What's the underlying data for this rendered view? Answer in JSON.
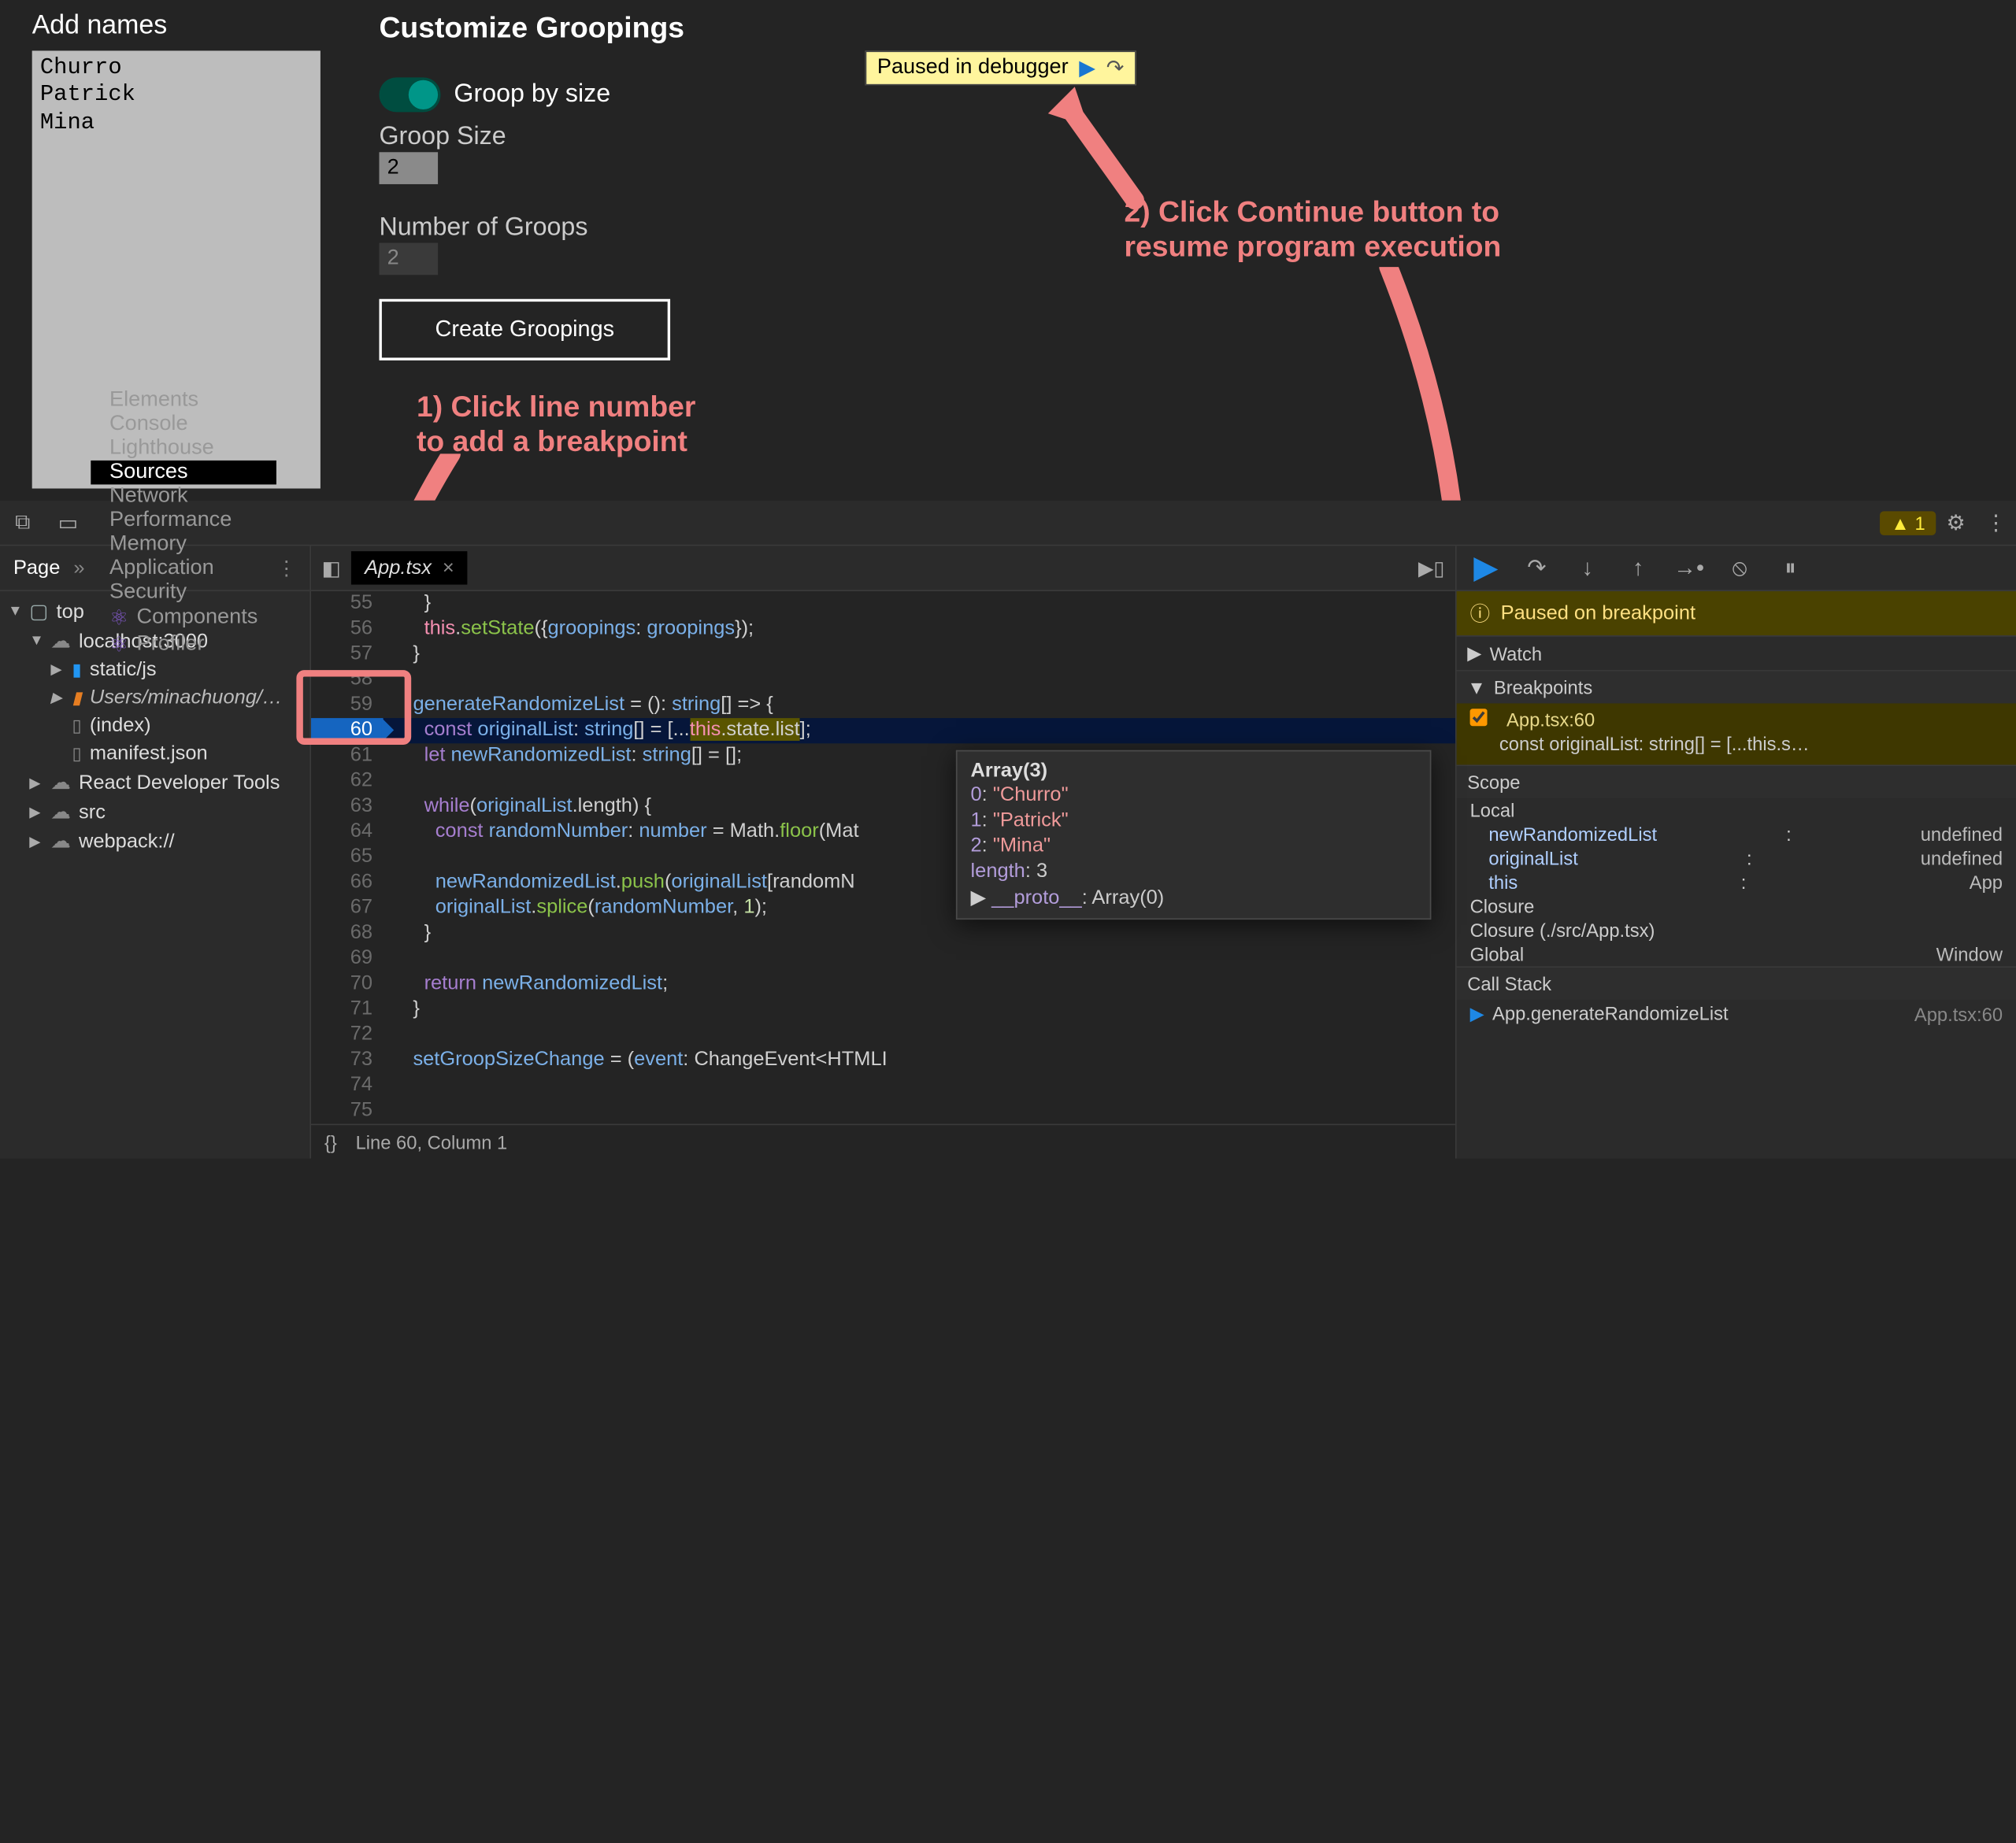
{
  "page": {
    "add_names_label": "Add names",
    "names_text": "Churro\nPatrick\nMina",
    "section_title": "Customize Groopings",
    "toggle_label": "Groop by size",
    "groop_size_label": "Groop Size",
    "groop_size_value": "2",
    "num_groops_label": "Number of Groops",
    "num_groops_value": "2",
    "create_label": "Create Groopings"
  },
  "paused_overlay": {
    "text": "Paused in debugger",
    "resume_glyph": "▶",
    "step_glyph": "↷"
  },
  "annotations": {
    "step1_line1": "1) Click line number",
    "step1_line2": "to add a breakpoint",
    "step2_line1": "2) Click Continue button to",
    "step2_line2": "resume program execution"
  },
  "devtools": {
    "tabs": [
      "Elements",
      "Console",
      "Lighthouse",
      "Sources",
      "Network",
      "Performance",
      "Memory",
      "Application",
      "Security",
      "Components",
      "Profiler"
    ],
    "active_tab": "Sources",
    "warn_count": "1",
    "nav": {
      "header": "Page",
      "more": "»",
      "tree": [
        {
          "depth": 0,
          "icon": "frame",
          "label": "top",
          "expander": "▼"
        },
        {
          "depth": 1,
          "icon": "cloud",
          "label": "localhost:3000",
          "expander": "▼"
        },
        {
          "depth": 2,
          "icon": "folderb",
          "label": "static/js",
          "expander": "▶"
        },
        {
          "depth": 2,
          "icon": "foldero",
          "label": "Users/minachuong/…",
          "italic": true,
          "expander": "▶"
        },
        {
          "depth": 2,
          "icon": "file",
          "label": "(index)"
        },
        {
          "depth": 2,
          "icon": "file",
          "label": "manifest.json"
        },
        {
          "depth": 1,
          "icon": "cloud",
          "label": "React Developer Tools",
          "expander": "▶"
        },
        {
          "depth": 1,
          "icon": "cloud",
          "label": "src",
          "expander": "▶"
        },
        {
          "depth": 1,
          "icon": "cloud",
          "label": "webpack://",
          "expander": "▶"
        }
      ]
    },
    "file_tab": "App.tsx",
    "code_lines": [
      {
        "n": 55,
        "html": "    }"
      },
      {
        "n": 56,
        "html": "    <span class='kwthis'>this</span>.<span class='func'>setState</span>({<span class='ident'>groopings</span>: <span class='ident'>groopings</span>});"
      },
      {
        "n": 57,
        "html": "  }"
      },
      {
        "n": 58,
        "html": ""
      },
      {
        "n": 59,
        "html": "  <span class='ident'>generateRandomizeList</span> = (): <span class='ident'>string</span>[] =&gt; {"
      },
      {
        "n": 60,
        "html": "    <span class='kw'>const</span> <span class='ident'>originalList</span>: <span class='ident'>string</span>[] = [...<span class='hl-this'><span class='kwthis'>this</span>.state.list</span>];",
        "bp": true,
        "current": true
      },
      {
        "n": 61,
        "html": "    <span class='kw'>let</span> <span class='ident'>newRandomizedList</span>: <span class='ident'>string</span>[] = [];"
      },
      {
        "n": 62,
        "html": ""
      },
      {
        "n": 63,
        "html": "    <span class='kw'>while</span>(<span class='ident'>originalList</span>.length) {"
      },
      {
        "n": 64,
        "html": "      <span class='kw'>const</span> <span class='ident'>randomNumber</span>: <span class='ident'>number</span> = Math.<span class='func'>floor</span>(Mat"
      },
      {
        "n": 65,
        "html": ""
      },
      {
        "n": 66,
        "html": "      <span class='ident'>newRandomizedList</span>.<span class='func'>push</span>(<span class='ident'>originalList</span>[randomN"
      },
      {
        "n": 67,
        "html": "      <span class='ident'>originalList</span>.<span class='func'>splice</span>(<span class='ident'>randomNumber</span>, <span class='num'>1</span>);"
      },
      {
        "n": 68,
        "html": "    }"
      },
      {
        "n": 69,
        "html": ""
      },
      {
        "n": 70,
        "html": "    <span class='kw'>return</span> <span class='ident'>newRandomizedList</span>;"
      },
      {
        "n": 71,
        "html": "  }"
      },
      {
        "n": 72,
        "html": ""
      },
      {
        "n": 73,
        "html": "  <span class='ident'>setGroopSizeChange</span> = (<span class='ident'>event</span>: ChangeEvent&lt;HTMLI"
      },
      {
        "n": 74,
        "html": ""
      },
      {
        "n": 75,
        "html": ""
      }
    ],
    "status": {
      "left_glyph": "{}",
      "pos": "Line 60, Column 1"
    },
    "tooltip": {
      "header": "Array(3)",
      "rows": [
        {
          "k": "0",
          "v": "\"Churro\""
        },
        {
          "k": "1",
          "v": "\"Patrick\""
        },
        {
          "k": "2",
          "v": "\"Mina\""
        }
      ],
      "length_label": "length",
      "length_value": "3",
      "proto_label": "__proto__",
      "proto_value": "Array(0)"
    },
    "debugger": {
      "banner": "Paused on breakpoint",
      "sections": {
        "watch": "Watch",
        "breakpoints": "Breakpoints",
        "scope": "Scope",
        "callstack": "Call Stack"
      },
      "bp_item": "App.tsx:60",
      "bp_snippet": "const originalList: string[] = [...this.s…",
      "scope_local_label": "Local",
      "scope_vars": [
        {
          "name": "newRandomizedList",
          "val": "undefined"
        },
        {
          "name": "originalList",
          "val": "undefined"
        },
        {
          "name": "this",
          "val": "App"
        }
      ],
      "closure1": "Closure",
      "closure2": "Closure (./src/App.tsx)",
      "global_label": "Global",
      "global_val": "Window",
      "stack_frame": "App.generateRandomizeList",
      "stack_loc": "App.tsx:60"
    }
  }
}
